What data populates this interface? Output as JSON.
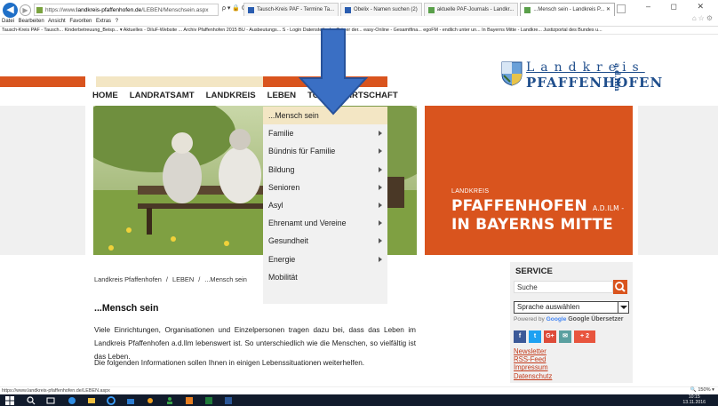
{
  "browser": {
    "url_prefix": "https://www.",
    "url_domain": "landkreis-pfaffenhofen.de",
    "url_path": "/LEBEN/Menschsein.aspx",
    "tools_label": "ρ ▾ 🔒 C",
    "tabs": [
      {
        "label": "Tausch-Kreis PAF - Termine Ta...",
        "color": "#2a5db0",
        "active": false
      },
      {
        "label": "Obelix - Namen suchen (2)",
        "color": "#2a5db0",
        "active": false
      },
      {
        "label": "aktuelle PAF-Journals - Landkr...",
        "color": "#5aa04a",
        "active": false
      },
      {
        "label": "...Mensch sein - Landkreis P... ✕",
        "color": "#5aa04a",
        "active": true
      }
    ],
    "window_controls": "– ◻ ✕",
    "menubar": "Datei Bearbeiten Ansicht Favoriten Extras ?",
    "favorites": "Tausch-Kreis PAF - Tausch...   Kinderbetreuung_Beisp... ▾   Aktuelles - DiluF-Website ...   Archiv Pfaffenhofen 2015   BU - Ausbeutungs...   S - Login   Datenstelle der Träger der...   easy-Online - Gesamtfina...   egoFM - endlich unter un...   In Bayerns Mitte - Landkre...   Justizportal des Bundes u...",
    "status_url": "https://www.landkreis-pfaffenhofen.de/LEBEN.aspx",
    "zoom": "🔍 150%  ▾",
    "tray_time": "10:15",
    "tray_date": "13.11.2016"
  },
  "logo": {
    "top": "Landkreis",
    "bottom": "PFAFFENHOFEN",
    "suffix": "a.d.Ilm"
  },
  "nav": {
    "items": [
      "HOME",
      "LANDRATSAMT",
      "LANDKREIS",
      "LEBEN",
      "TO",
      "WIRTSCHAFT"
    ]
  },
  "dropdown": {
    "items": [
      {
        "label": "...Mensch sein",
        "submenu": false
      },
      {
        "label": "Familie",
        "submenu": true
      },
      {
        "label": "Bündnis für Familie",
        "submenu": true
      },
      {
        "label": "Bildung",
        "submenu": true
      },
      {
        "label": "Senioren",
        "submenu": true
      },
      {
        "label": "Asyl",
        "submenu": true
      },
      {
        "label": "Ehrenamt und Vereine",
        "submenu": true
      },
      {
        "label": "Gesundheit",
        "submenu": true
      },
      {
        "label": "Energie",
        "submenu": true
      },
      {
        "label": "Mobilität",
        "submenu": false
      }
    ]
  },
  "hero": {
    "small": "LANDKREIS",
    "line1": "PFAFFENHOFEN",
    "line1_suffix": "A.D.ILM -",
    "line2": "IN BAYERNS MITTE"
  },
  "breadcrumb": {
    "items": [
      "Landkreis Pfaffenhofen",
      "LEBEN",
      "...Mensch sein"
    ],
    "separator": "/"
  },
  "content": {
    "title": "...Mensch sein",
    "intro": "Viele Einrichtungen, Organisationen und Einzelpersonen tragen dazu bei, dass das Leben im Landkreis Pfaffenhofen a.d.Ilm lebenswert ist. So unterschiedlich wie die Menschen, so vielfältig ist das Leben.",
    "help": "Die folgenden Informationen sollen Ihnen in einigen Lebenssituationen weiterhelfen."
  },
  "service": {
    "title": "SERVICE",
    "search_value": "Suche",
    "language_value": "Sprache auswählen",
    "powered_prefix": "Powered by",
    "powered_google": "Google",
    "powered_translate": "Google Übersetzer",
    "social": [
      "f",
      "t",
      "G+",
      "✉",
      "+ 2"
    ],
    "links": [
      "Newsletter",
      "RSS-Feed",
      "Impressum",
      "Datenschutz"
    ]
  },
  "colors": {
    "accent": "#d9541e",
    "beige": "#f3e6c4",
    "logo_blue": "#1f4e8c",
    "arrow_blue": "#3a6fc4"
  }
}
